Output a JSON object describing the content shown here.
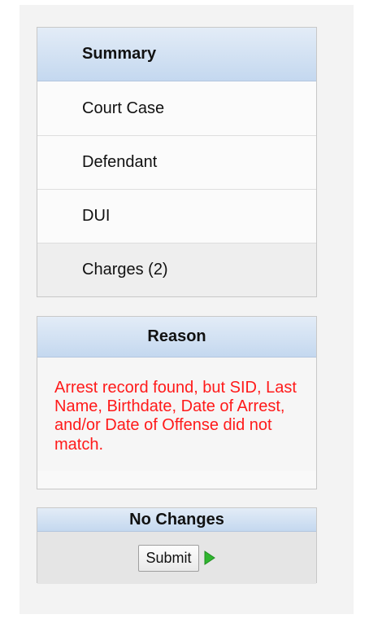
{
  "summary": {
    "title": "Summary",
    "items": [
      {
        "label": "Court Case"
      },
      {
        "label": "Defendant"
      },
      {
        "label": "DUI"
      },
      {
        "label": "Charges (2)"
      }
    ]
  },
  "reason": {
    "title": "Reason",
    "message": "Arrest record found, but SID, Last Name, Birthdate, Date of Arrest, and/or Date of Offense did not match."
  },
  "action": {
    "title": "No Changes",
    "submit_label": "Submit",
    "arrow_icon": "play-arrow-icon",
    "arrow_color": "#2fb52f"
  },
  "colors": {
    "header_gradient_top": "#e3ecf7",
    "header_gradient_bottom": "#c4d8ef",
    "reason_text": "#ff1a1a"
  }
}
